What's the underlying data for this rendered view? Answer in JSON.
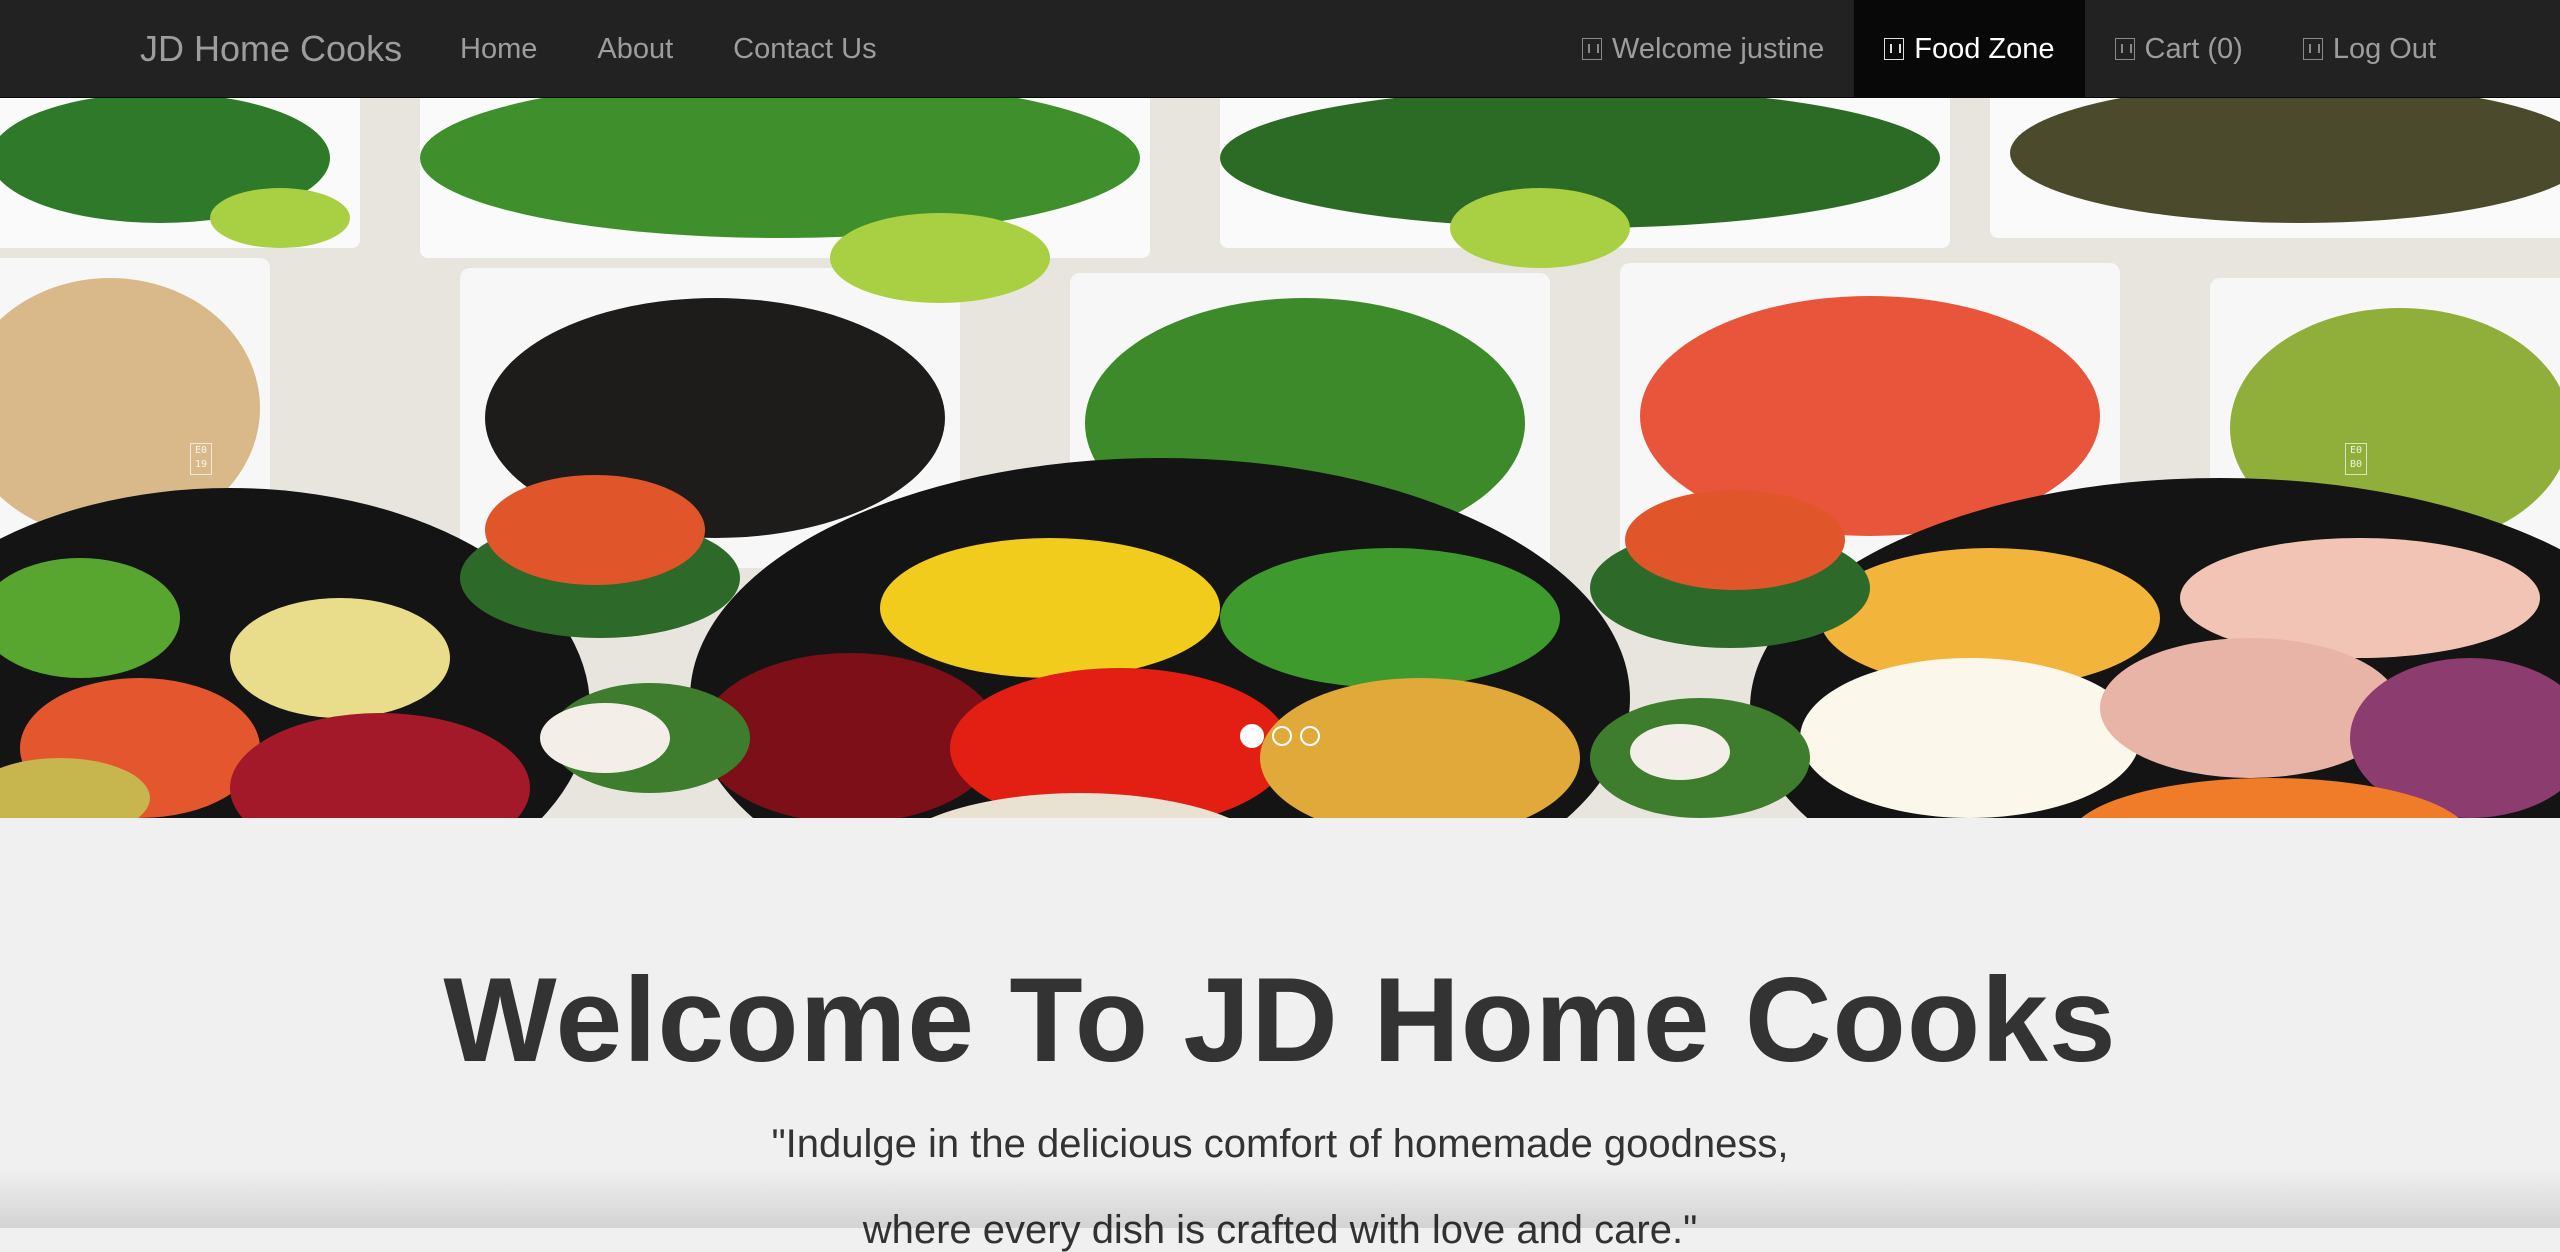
{
  "navbar": {
    "brand": "JD Home Cooks",
    "left_links": [
      {
        "label": "Home"
      },
      {
        "label": "About"
      },
      {
        "label": "Contact Us"
      }
    ],
    "right_links": [
      {
        "label": "Welcome justine",
        "icon": "user-icon"
      },
      {
        "label": "Food Zone",
        "icon": "food-icon",
        "active": true
      },
      {
        "label": "Cart (0)",
        "icon": "cart-icon"
      },
      {
        "label": "Log Out",
        "icon": "logout-icon"
      }
    ]
  },
  "carousel": {
    "active_slide": 1,
    "slide_count": 3,
    "prev_glyph": "E0\n19",
    "next_glyph": "E0\nB0"
  },
  "main": {
    "heading": "Welcome To JD Home Cooks",
    "tagline_line1": "\"Indulge in the delicious comfort of homemade goodness,",
    "tagline_line2": "where every dish is crafted with love and care.\""
  },
  "colors": {
    "navbar_bg": "#222222",
    "active_nav_bg": "#080808",
    "page_bg": "#f0f0f0",
    "heading": "#333333"
  }
}
